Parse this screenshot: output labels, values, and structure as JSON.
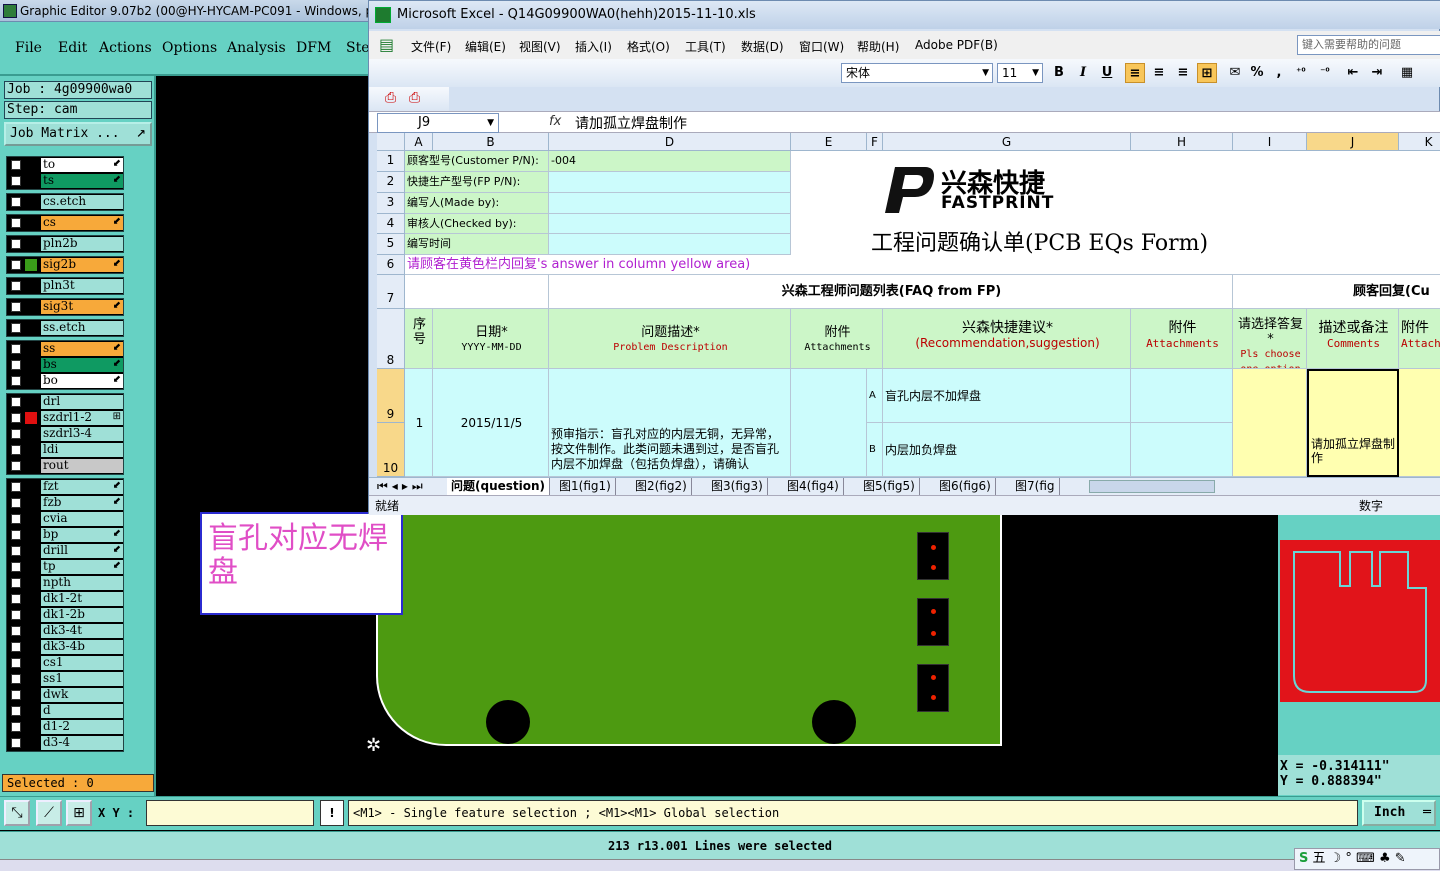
{
  "editor": {
    "title": "Graphic Editor 9.07b2 (00@HY-HYCAM-PC091 - Windows, p",
    "menu": [
      "File",
      "Edit",
      "Actions",
      "Options",
      "Analysis",
      "DFM",
      "Ste"
    ],
    "job_label": "Job : 4g09900wa0",
    "step_label": "Step: cam",
    "job_matrix_label": "Job Matrix ...",
    "selected_label": "Selected : 0",
    "callout_text": "盲孔对应无焊盘",
    "coords": {
      "x": "X = -0.314111\"",
      "y": "Y = 0.888394\""
    },
    "xy_label": "X Y :",
    "warn_symbol": "!",
    "hint": "<M1> - Single feature selection ; <M1><M1> Global selection",
    "unit": "Inch",
    "status": "213 r13.001 Lines were selected",
    "tray": "五 ☽ ° ⌨ ♣ ✎"
  },
  "layers": [
    [
      {
        "name": "to",
        "bg": "#ffffff",
        "sel": "#000000",
        "mark": "⬋"
      },
      {
        "name": "ts",
        "bg": "#0f9a62",
        "sel": "#000000",
        "mark": "⬋"
      }
    ],
    [
      {
        "name": "cs.etch",
        "bg": "#9fe0d7",
        "sel": "#000000",
        "mark": ""
      }
    ],
    [
      {
        "name": "cs",
        "bg": "#f7a93a",
        "sel": "#000000",
        "mark": "⬋"
      }
    ],
    [
      {
        "name": "pln2b",
        "bg": "#9fe0d7",
        "sel": "#000000",
        "mark": ""
      }
    ],
    [
      {
        "name": "sig2b",
        "bg": "#f7a93a",
        "sel": "#3a9c1a",
        "mark": "⬋"
      }
    ],
    [
      {
        "name": "pln3t",
        "bg": "#9fe0d7",
        "sel": "#000000",
        "mark": ""
      }
    ],
    [
      {
        "name": "sig3t",
        "bg": "#f7a93a",
        "sel": "#000000",
        "mark": "⬋"
      }
    ],
    [
      {
        "name": "ss.etch",
        "bg": "#9fe0d7",
        "sel": "#000000",
        "mark": ""
      }
    ],
    [
      {
        "name": "ss",
        "bg": "#f7a93a",
        "sel": "#000000",
        "mark": "⬋"
      },
      {
        "name": "bs",
        "bg": "#0f9a62",
        "sel": "#000000",
        "mark": "⬋"
      },
      {
        "name": "bo",
        "bg": "#ffffff",
        "sel": "#000000",
        "mark": "⬋"
      }
    ],
    [
      {
        "name": "drl",
        "bg": "#9fe0d7",
        "sel": "#000000",
        "mark": ""
      },
      {
        "name": "szdrl1-2",
        "bg": "#9fe0d7",
        "sel": "#e01010",
        "mark": "⊞"
      },
      {
        "name": "szdrl3-4",
        "bg": "#9fe0d7",
        "sel": "#000000",
        "mark": ""
      },
      {
        "name": "ldi",
        "bg": "#9fe0d7",
        "sel": "#000000",
        "mark": ""
      },
      {
        "name": "rout",
        "bg": "#c8c8c8",
        "sel": "#000000",
        "mark": ""
      }
    ],
    [
      {
        "name": "fzt",
        "bg": "#9fe0d7",
        "sel": "#000000",
        "mark": "⬋"
      },
      {
        "name": "fzb",
        "bg": "#9fe0d7",
        "sel": "#000000",
        "mark": "⬋"
      },
      {
        "name": "cvia",
        "bg": "#9fe0d7",
        "sel": "#000000",
        "mark": ""
      },
      {
        "name": "bp",
        "bg": "#9fe0d7",
        "sel": "#000000",
        "mark": "⬋"
      },
      {
        "name": "drill",
        "bg": "#9fe0d7",
        "sel": "#000000",
        "mark": "⬋"
      },
      {
        "name": "tp",
        "bg": "#9fe0d7",
        "sel": "#000000",
        "mark": "⬋"
      },
      {
        "name": "npth",
        "bg": "#9fe0d7",
        "sel": "#000000",
        "mark": ""
      },
      {
        "name": "dk1-2t",
        "bg": "#9fe0d7",
        "sel": "#000000",
        "mark": ""
      },
      {
        "name": "dk1-2b",
        "bg": "#9fe0d7",
        "sel": "#000000",
        "mark": ""
      },
      {
        "name": "dk3-4t",
        "bg": "#9fe0d7",
        "sel": "#000000",
        "mark": ""
      },
      {
        "name": "dk3-4b",
        "bg": "#9fe0d7",
        "sel": "#000000",
        "mark": ""
      },
      {
        "name": "cs1",
        "bg": "#9fe0d7",
        "sel": "#000000",
        "mark": ""
      },
      {
        "name": "ss1",
        "bg": "#9fe0d7",
        "sel": "#000000",
        "mark": ""
      },
      {
        "name": "dwk",
        "bg": "#9fe0d7",
        "sel": "#000000",
        "mark": ""
      },
      {
        "name": "d",
        "bg": "#9fe0d7",
        "sel": "#000000",
        "mark": ""
      },
      {
        "name": "d1-2",
        "bg": "#9fe0d7",
        "sel": "#000000",
        "mark": ""
      },
      {
        "name": "d3-4",
        "bg": "#9fe0d7",
        "sel": "#000000",
        "mark": ""
      }
    ]
  ],
  "excel": {
    "title": "Microsoft Excel - Q14G09900WA0(hehh)2015-11-10.xls",
    "menu": [
      "文件(F)",
      "编辑(E)",
      "视图(V)",
      "插入(I)",
      "格式(O)",
      "工具(T)",
      "数据(D)",
      "窗口(W)",
      "帮助(H)",
      "Adobe PDF(B)"
    ],
    "help_placeholder": "键入需要帮助的问题",
    "font": "宋体",
    "font_size": "11",
    "toolbar_buttons": [
      "B",
      "I",
      "U",
      "≡",
      "≡",
      "≡",
      "⊞",
      "✉",
      "%",
      ",",
      "⁺⁰",
      "⁻⁰",
      "⇤",
      "⇥",
      "▦"
    ],
    "name_box": "J9",
    "fx": "fx",
    "formula": "请加孤立焊盘制作",
    "columns": [
      "A",
      "B",
      "D",
      "E",
      "F",
      "G",
      "H",
      "I",
      "J",
      "K"
    ],
    "rows": [
      "1",
      "2",
      "3",
      "4",
      "5",
      "6",
      "7",
      "8",
      "9",
      "10"
    ],
    "cells": {
      "r1_label": "顾客型号(Customer P/N):",
      "r1_value": "-004",
      "r2_label": "快捷生产型号(FP P/N):",
      "r3_label": "编写人(Made by):",
      "r4_label": "审核人(Checked by):",
      "r5_label": "编写时间",
      "r6_note": "请顾客在黄色栏内回复's answer in column yellow area)",
      "r7_fp": "兴森工程师问题列表(FAQ from FP)",
      "r7_cust": "顾客回复(Cu",
      "h_seq": "序号",
      "h_date": "日期*",
      "h_date_sub": "YYYY-MM-DD",
      "h_prob": "问题描述*",
      "h_prob_sub": "Problem Description",
      "h_att": "附件",
      "h_att_sub": "Attachments",
      "h_rec": "兴森快捷建议*",
      "h_rec_sub": "(Recommendation,suggestion)",
      "h_att2": "附件",
      "h_att2_sub": "Attachments",
      "h_choose": "请选择答复*",
      "h_choose_sub": "Pls choose one option",
      "h_comment": "描述或备注",
      "h_comment_sub": "Comments",
      "h_att3": "附件",
      "h_att3_sub": "Attach",
      "seq": "1",
      "date": "2015/11/5",
      "problem": "预审指示：盲孔对应的内层无铜，无异常，按文件制作。此类问题未遇到过，是否盲孔内层不加焊盘（包括负焊盘），请确认",
      "opt_a": "A",
      "opt_a_text": "盲孔内层不加焊盘",
      "opt_b": "B",
      "opt_b_text": "内层加负焊盘",
      "comment": "请加孤立焊盘制作"
    },
    "logo_cn": "兴森快捷",
    "logo_en": "FASTPRINT",
    "form_title": "工程问题确认单(PCB EQs Form)",
    "tabs": [
      "问题(question)",
      "图1(fig1)",
      "图2(fig2)",
      "图3(fig3)",
      "图4(fig4)",
      "图5(fig5)",
      "图6(fig6)",
      "图7(fig"
    ],
    "status_left": "就绪",
    "status_right": "数字"
  }
}
